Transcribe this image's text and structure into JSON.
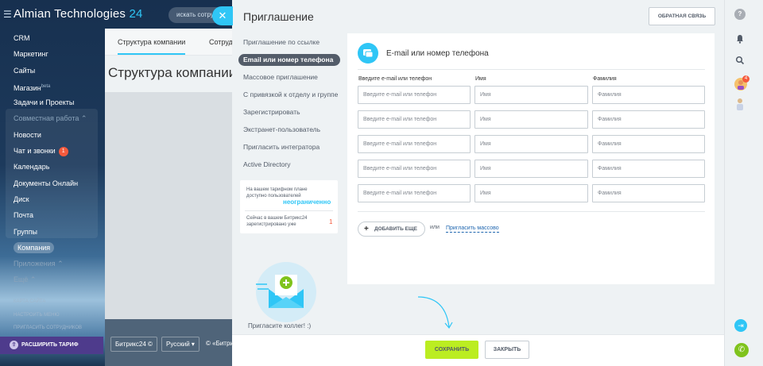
{
  "background": {
    "logo": "Almian Technologies",
    "logo_num": "24",
    "search_placeholder": "искать сотрудников",
    "menu": [
      {
        "label": "CRM"
      },
      {
        "label": "Маркетинг"
      },
      {
        "label": "Сайты"
      },
      {
        "label": "Магазин",
        "sup": "beta"
      },
      {
        "label": "Задачи и Проекты"
      },
      {
        "label": "Совместная работа",
        "group": true
      },
      {
        "label": "Новости"
      },
      {
        "label": "Чат и звонки",
        "badge": "1"
      },
      {
        "label": "Календарь"
      },
      {
        "label": "Документы Онлайн"
      },
      {
        "label": "Диск"
      },
      {
        "label": "Почта"
      },
      {
        "label": "Группы"
      },
      {
        "label": "Компания",
        "pill": true
      },
      {
        "label": "Приложения",
        "group": true
      },
      {
        "label": "Ещё",
        "group": true
      }
    ],
    "small_links": [
      "Карта сайта",
      "Настроить меню",
      "Пригласить сотрудников"
    ],
    "expand_label": "РАСШИРИТЬ ТАРИФ",
    "tabs": [
      "Структура компании",
      "Сотрудники"
    ],
    "page_title": "Структура компании",
    "footer": {
      "brand": "Битрикс24",
      "lang": "Русский",
      "copy": "© «Битрикс»"
    }
  },
  "slider": {
    "title": "Приглашение",
    "feedback": "ОБРАТНАЯ СВЯЗЬ",
    "nav": [
      "Приглашение по ссылке",
      "Email или номер телефона",
      "Массовое приглашение",
      "С привязкой к отделу и группе",
      "Зарегистрировать",
      "Экстранет-пользователь",
      "Пригласить интегратора",
      "Active Directory"
    ],
    "active_nav": 1,
    "info": {
      "plan_text": "На вашем тарифном плане доступно пользователей",
      "plan_value": "неограниченно",
      "registered_text": "Сейчас в вашем Битрикс24 зарегистрировано уже",
      "registered_value": "1"
    },
    "promo_text": "Пригласите коллег! :)",
    "form": {
      "header": "E-mail или номер телефона",
      "labels": [
        "Введите e-mail или телефон",
        "Имя",
        "Фамилия"
      ],
      "placeholders": [
        "Введите e-mail или телефон",
        "Имя",
        "Фамилия"
      ],
      "rows": 5,
      "add_more": "ДОБАВИТЬ ЕЩЕ",
      "or": "или",
      "mass_link": "Пригласить массово"
    },
    "buttons": {
      "save": "СОХРАНИТЬ",
      "close": "ЗАКРЫТЬ"
    }
  },
  "right_panel": {
    "notification_badge": "4"
  },
  "colors": {
    "accent": "#2fc6f6",
    "save": "#bbed21",
    "badge": "#f55a3d",
    "purple": "#4e3b8c"
  }
}
